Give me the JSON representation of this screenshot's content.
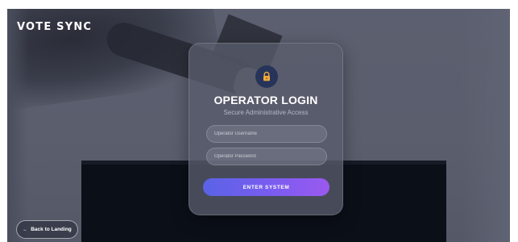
{
  "app": {
    "brand": "VOTE SYNC"
  },
  "login": {
    "icon": "lock-icon",
    "title": "OPERATOR LOGIN",
    "subtitle": "Secure Administrative Access",
    "username_placeholder": "Operator Username",
    "username_value": "",
    "password_placeholder": "Operator Password",
    "password_value": "",
    "submit_label": "ENTER SYSTEM"
  },
  "nav": {
    "back_icon": "arrow-left-icon",
    "back_arrow": "←",
    "back_label": "Back to Landing"
  },
  "colors": {
    "accent_start": "#5a63e6",
    "accent_end": "#9b59ef",
    "lock_badge": "#27345a",
    "lock_color": "#f2a93b"
  }
}
